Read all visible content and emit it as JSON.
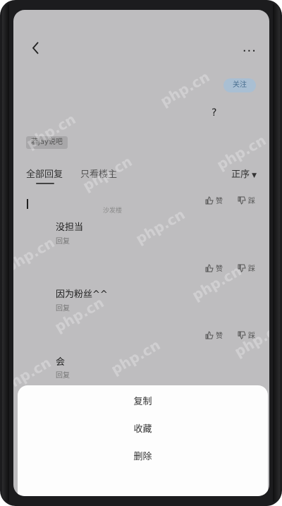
{
  "header": {
    "follow_label": "关注"
  },
  "question": {
    "text": "?"
  },
  "tag": {
    "label": "若jay说吧"
  },
  "tabs": [
    {
      "label": "全部回复"
    },
    {
      "label": "只看楼主"
    }
  ],
  "sort": {
    "label": "正序"
  },
  "floor_label": "沙发楼",
  "votes": [
    {
      "up": "赞",
      "down": "踩"
    },
    {
      "up": "赞",
      "down": "踩"
    },
    {
      "up": "赞",
      "down": "踩"
    }
  ],
  "replies": [
    {
      "text": "没担当",
      "action": "回复"
    },
    {
      "text": "因为粉丝^^",
      "action": "回复"
    },
    {
      "text": "会",
      "action": "回复"
    }
  ],
  "sheet": {
    "items": [
      "复制",
      "收藏",
      "删除"
    ]
  },
  "watermark": "php.cn"
}
